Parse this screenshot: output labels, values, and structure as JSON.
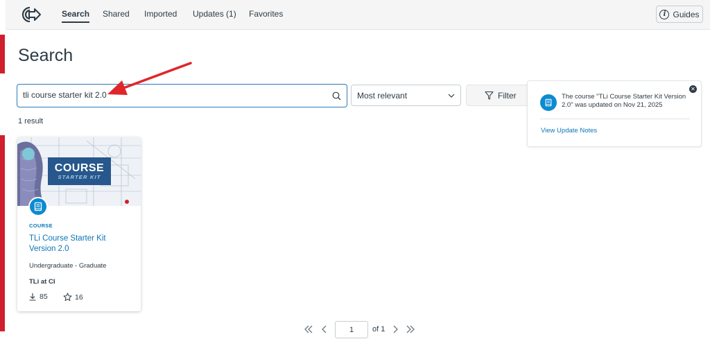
{
  "nav": {
    "tabs": [
      {
        "label": "Search",
        "active": true
      },
      {
        "label": "Shared",
        "active": false
      },
      {
        "label": "Imported",
        "active": false
      },
      {
        "label": "Updates (1)",
        "active": false
      },
      {
        "label": "Favorites",
        "active": false
      }
    ],
    "guides_label": "Guides"
  },
  "page": {
    "title": "Search"
  },
  "search": {
    "value": "tli course starter kit 2.0",
    "sort_selected": "Most relevant",
    "filter_label": "Filter",
    "result_count": "1 result"
  },
  "results": [
    {
      "banner_line1": "COURSE",
      "banner_line2": "STARTER KIT",
      "type": "COURSE",
      "title": "TLi Course Starter Kit Version 2.0",
      "level": "Undergraduate - Graduate",
      "author": "TLi at CI",
      "downloads": "85",
      "favorites": "16"
    }
  ],
  "notification": {
    "message": "The course \"TLi Course Starter Kit Version 2.0\" was updated on Nov 21, 2025",
    "link_label": "View Update Notes"
  },
  "pagination": {
    "current_page": "1",
    "of_label": "of 1"
  },
  "colors": {
    "accent": "#0b76b7",
    "badge": "#0d8bd1",
    "annotation_arrow": "#e0262a",
    "banner": "#27578c"
  }
}
